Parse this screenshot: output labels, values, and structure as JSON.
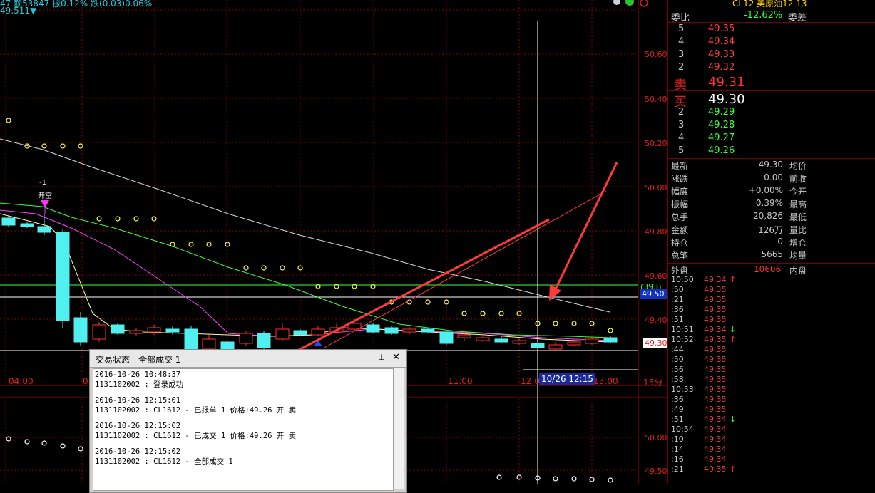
{
  "status": {
    "top_line": "47 额53847 振0.12% 跌(0.03)0.06%",
    "sub_line": "49.511▼"
  },
  "chart": {
    "y_labels": [
      "50.60",
      "50.40",
      "50.20",
      "50.00",
      "49.80",
      "49.60",
      "49.40",
      "50.00",
      "49.50"
    ],
    "time_labels": [
      "04:00",
      "0",
      "11:00",
      "12:0",
      "13:00"
    ],
    "period_label": "15分",
    "cursor_time": "10/26 12:15",
    "marker_count": "-1",
    "marker_label": "开空",
    "hline_tag": "(393)",
    "hline_price": "49.50",
    "last_price_tag": "49.30",
    "colors": {
      "up": "#ff3030",
      "down": "#50f0f0",
      "ma1": "#ffffa0",
      "ma2": "#ff40ff",
      "ma3": "#40ff40",
      "ma4": "#d8d8d8",
      "arrow": "#ff3a3a",
      "sar": "#ffff40"
    }
  },
  "panel": {
    "title": "CL12 美原油12  13",
    "weibi_label": "委比",
    "weibi_value": "-12.62%",
    "weicha_label": "委差",
    "asks": [
      {
        "level": "5",
        "price": "49.35"
      },
      {
        "level": "4",
        "price": "49.34"
      },
      {
        "level": "3",
        "price": "49.33"
      },
      {
        "level": "2",
        "price": "49.32"
      }
    ],
    "sell_label": "卖",
    "sell_price": "49.31",
    "buy_label": "买",
    "buy_price": "49.30",
    "bids": [
      {
        "level": "2",
        "price": "49.29"
      },
      {
        "level": "3",
        "price": "49.28"
      },
      {
        "level": "4",
        "price": "49.27"
      },
      {
        "level": "5",
        "price": "49.26"
      }
    ],
    "quote": [
      {
        "label": "最新",
        "value": "49.30",
        "right": "均价",
        "color": "#c8c8c8"
      },
      {
        "label": "涨跌",
        "value": "0.00",
        "right": "前收",
        "color": "#c8c8c8"
      },
      {
        "label": "幅度",
        "value": "+0.00%",
        "right": "今开",
        "color": "#c8c8c8"
      },
      {
        "label": "振幅",
        "value": "0.39%",
        "right": "最高",
        "color": "#c8c8c8"
      },
      {
        "label": "总手",
        "value": "20,826",
        "right": "最低",
        "color": "#c8c8c8"
      },
      {
        "label": "金额",
        "value": "126万",
        "right": "量比",
        "color": "#c8c8c8"
      },
      {
        "label": "持仓",
        "value": "0",
        "right": "增仓",
        "color": "#c8c8c8"
      },
      {
        "label": "总笔",
        "value": "5665",
        "right": "均量",
        "color": "#c8c8c8"
      }
    ],
    "waipan_label": "外盘",
    "waipan_value": "10606",
    "neipan_label": "内盘",
    "ticks": [
      {
        "t": "10:50",
        "p": "49.34",
        "a": "↑",
        "c": "#ff3030"
      },
      {
        "t": ":50",
        "p": "49.35",
        "a": "",
        "c": ""
      },
      {
        "t": ":21",
        "p": "49.35",
        "a": "",
        "c": ""
      },
      {
        "t": ":36",
        "p": "49.35",
        "a": "",
        "c": ""
      },
      {
        "t": ":51",
        "p": "49.35",
        "a": "",
        "c": ""
      },
      {
        "t": "10:51",
        "p": "49.34",
        "a": "↓",
        "c": "#30ff30"
      },
      {
        "t": "10:52",
        "p": "49.35",
        "a": "↑",
        "c": "#ff3030"
      },
      {
        "t": ":44",
        "p": "49.35",
        "a": "",
        "c": ""
      },
      {
        "t": ":50",
        "p": "49.35",
        "a": "",
        "c": ""
      },
      {
        "t": ":56",
        "p": "49.35",
        "a": "",
        "c": ""
      },
      {
        "t": ":58",
        "p": "49.35",
        "a": "",
        "c": ""
      },
      {
        "t": "10:53",
        "p": "49.35",
        "a": "",
        "c": ""
      },
      {
        "t": ":36",
        "p": "49.35",
        "a": "",
        "c": ""
      },
      {
        "t": ":49",
        "p": "49.35",
        "a": "",
        "c": ""
      },
      {
        "t": ":51",
        "p": "49.34",
        "a": "↓",
        "c": "#30ff30"
      },
      {
        "t": "10:54",
        "p": "49.34",
        "a": "",
        "c": ""
      },
      {
        "t": ":10",
        "p": "49.34",
        "a": "",
        "c": ""
      },
      {
        "t": ":14",
        "p": "49.34",
        "a": "",
        "c": ""
      },
      {
        "t": ":16",
        "p": "49.34",
        "a": "",
        "c": ""
      },
      {
        "t": ":21",
        "p": "49.35",
        "a": "↑",
        "c": "#ff3030"
      }
    ]
  },
  "dialog": {
    "title": "交易状态 - 全部成交 1",
    "pin": "⊥",
    "close": "✕",
    "lines": [
      "2016-10-26 10:48:37",
      "1131102002 : 登录成功",
      "",
      "2016-10-26 12:15:01",
      "1131102002 : CL1612 - 已报单 1 价格:49.26 开 卖",
      "",
      "2016-10-26 12:15:02",
      "1131102002 : CL1612 - 已成交 1 价格:49.26 开 卖",
      "",
      "2016-10-26 12:15:02",
      "1131102002 : CL1612 - 全部成交 1"
    ]
  }
}
